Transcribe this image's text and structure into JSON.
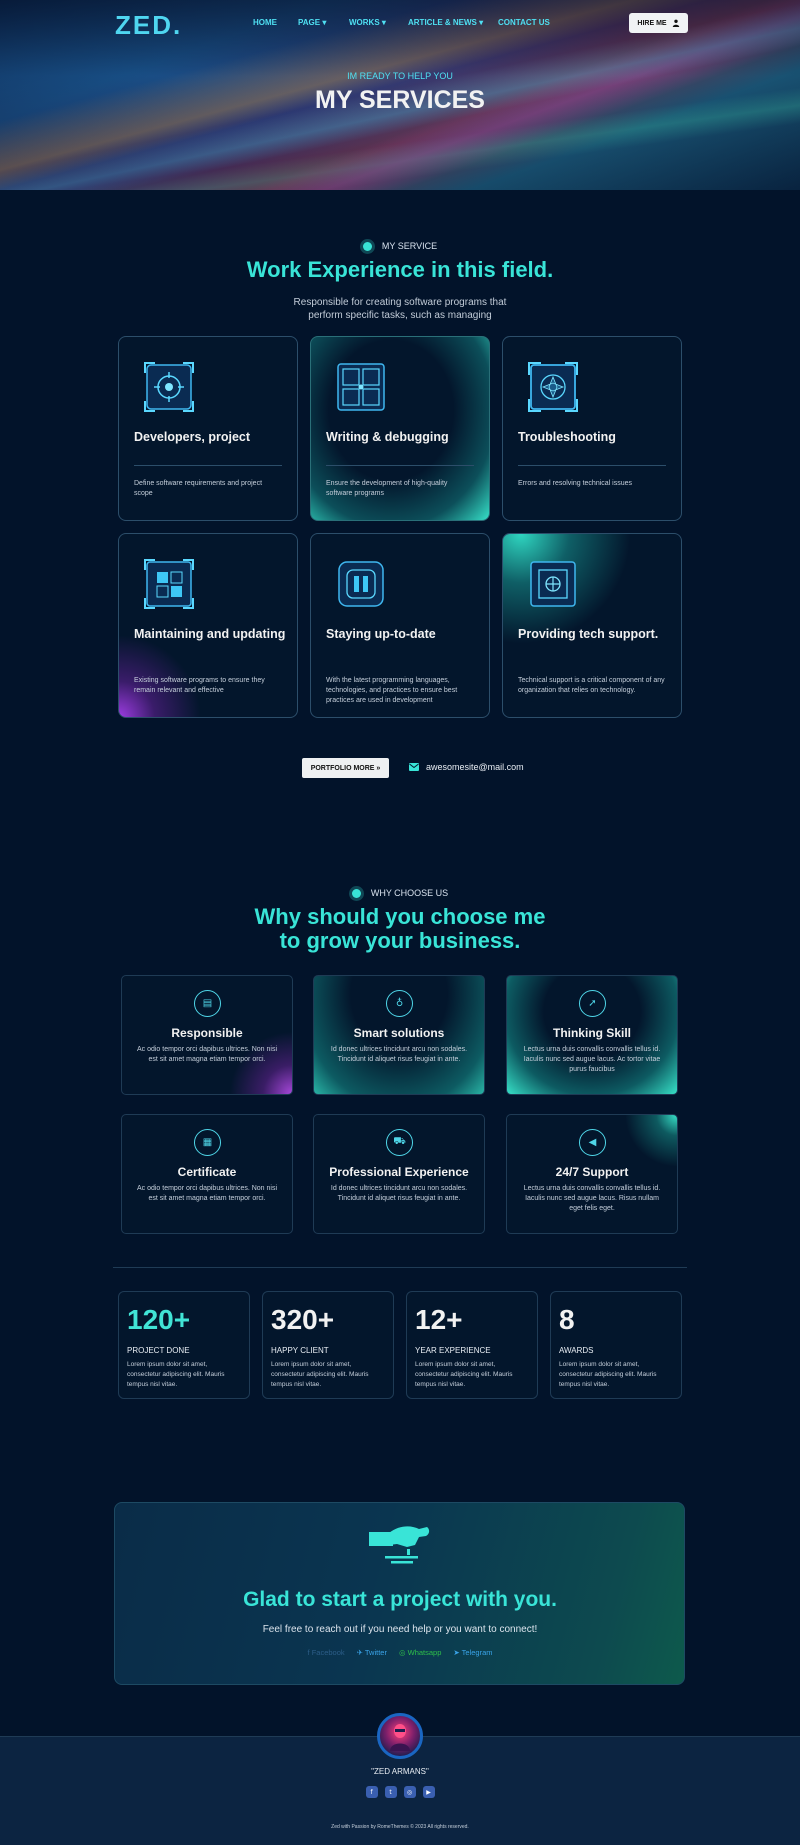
{
  "header": {
    "logo": "ZED.",
    "nav": [
      {
        "label": "HOME",
        "dropdown": false
      },
      {
        "label": "PAGE",
        "dropdown": true
      },
      {
        "label": "WORKS",
        "dropdown": true
      },
      {
        "label": "ARTICLE & NEWS",
        "dropdown": true
      },
      {
        "label": "CONTACT US",
        "dropdown": false
      }
    ],
    "hire_label": "HIRE ME"
  },
  "hero": {
    "subtitle": "IM READY TO HELP YOU",
    "title": "MY SERVICES"
  },
  "services": {
    "tag": "MY SERVICE",
    "heading": "Work Experience in this field.",
    "lead_line1": "Responsible for creating software programs that",
    "lead_line2": "perform specific tasks, such as managing",
    "cards": [
      {
        "title": "Developers, project",
        "desc": "Define software requirements and project scope",
        "icon": "target-chip-icon"
      },
      {
        "title": "Writing & debugging",
        "desc": "Ensure the development of high-quality software programs",
        "icon": "grid-chip-icon"
      },
      {
        "title": "Troubleshooting",
        "desc": "Errors and resolving technical issues",
        "icon": "crosshair-chip-icon"
      },
      {
        "title": "Maintaining and updating",
        "desc": "Existing software programs to ensure they remain relevant and effective",
        "icon": "blocks-chip-icon"
      },
      {
        "title": "Staying up-to-date",
        "desc": "With the latest programming languages, technologies, and practices to ensure best practices are used in development",
        "icon": "pause-chip-icon"
      },
      {
        "title": "Providing tech support.",
        "desc": "Technical support is a critical component of any organization that relies on technology.",
        "icon": "support-chip-icon"
      }
    ],
    "portfolio_label": "PORTFOLIO MORE",
    "email": "awesomesite@mail.com"
  },
  "why": {
    "tag": "WHY CHOOSE US",
    "heading_line1": "Why should you choose me",
    "heading_line2": "to grow your business.",
    "cards": [
      {
        "title": "Responsible",
        "desc": "Ac odio tempor orci dapibus ultrices. Non nisi est sit amet magna etiam tempor orci.",
        "icon": "chat-icon"
      },
      {
        "title": "Smart solutions",
        "desc": "Id donec ultrices tincidunt arcu non sodales. Tincidunt id aliquet risus feugiat in ante.",
        "icon": "bulb-icon"
      },
      {
        "title": "Thinking Skill",
        "desc": "Lectus urna duis convallis convallis tellus id. Iaculis nunc sed augue lacus. Ac tortor vitae purus faucibus",
        "icon": "rocket-icon"
      },
      {
        "title": "Certificate",
        "desc": "Ac odio tempor orci dapibus ultrices. Non nisi est sit amet magna etiam tempor orci.",
        "icon": "certificate-icon"
      },
      {
        "title": "Professional Experience",
        "desc": "Id donec ultrices tincidunt arcu non sodales. Tincidunt id aliquet risus feugiat in ante.",
        "icon": "truck-icon"
      },
      {
        "title": "24/7 Support",
        "desc": "Lectus urna duis convallis convallis tellus id. Iaculis nunc sed augue lacus. Risus nullam eget felis eget.",
        "icon": "megaphone-icon"
      }
    ]
  },
  "stats": [
    {
      "number": "120+",
      "label": "PROJECT DONE",
      "desc": "Lorem ipsum dolor sit amet, consectetur adipiscing elit. Mauris tempus nisl vitae."
    },
    {
      "number": "320+",
      "label": "HAPPY CLIENT",
      "desc": "Lorem ipsum dolor sit amet, consectetur adipiscing elit. Mauris tempus nisl vitae."
    },
    {
      "number": "12+",
      "label": "YEAR EXPERIENCE",
      "desc": "Lorem ipsum dolor sit amet, consectetur adipiscing elit. Mauris tempus nisl vitae."
    },
    {
      "number": "8",
      "label": "AWARDS",
      "desc": "Lorem ipsum dolor sit amet, consectetur adipiscing elit. Mauris tempus nisl vitae."
    }
  ],
  "cta": {
    "title": "Glad to start a project with you.",
    "subtitle": "Feel free to reach out if you need help or you want to connect!",
    "socials": [
      {
        "label": "Facebook",
        "color": "#2c5d88"
      },
      {
        "label": "Twitter",
        "color": "#3aa3e8"
      },
      {
        "label": "Whatsapp",
        "color": "#2fbf4a"
      },
      {
        "label": "Telegram",
        "color": "#3aa3e8"
      }
    ]
  },
  "footer": {
    "name": "\"ZED ARMANS\"",
    "copyright": "Zed with Passion by RomeThemes © 2023 All rights reserved."
  },
  "colors": {
    "accent": "#39e4d7",
    "background": "#02132a",
    "footer_bg": "#0c2441"
  }
}
